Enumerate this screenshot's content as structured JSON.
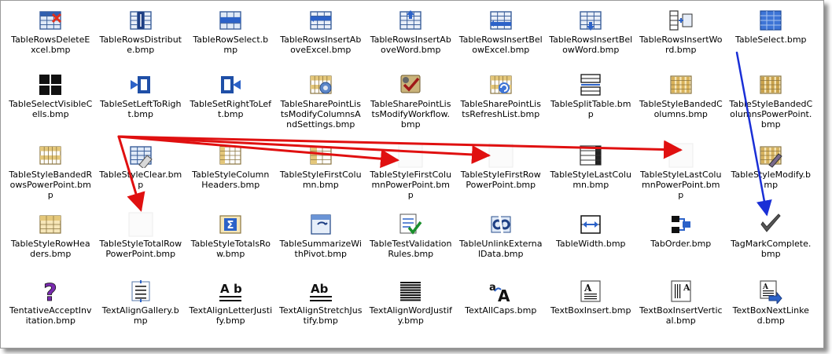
{
  "files": [
    {
      "label": "TableRowsDeleteExcel.bmp",
      "icon": "table-rows-delete-excel-icon"
    },
    {
      "label": "TableRowsDistribute.bmp",
      "icon": "table-rows-distribute-icon"
    },
    {
      "label": "TableRowSelect.bmp",
      "icon": "table-row-select-icon"
    },
    {
      "label": "TableRowsInsertAboveExcel.bmp",
      "icon": "table-rows-insert-above-excel-icon"
    },
    {
      "label": "TableRowsInsertAboveWord.bmp",
      "icon": "table-rows-insert-above-word-icon"
    },
    {
      "label": "TableRowsInsertBelowExcel.bmp",
      "icon": "table-rows-insert-below-excel-icon"
    },
    {
      "label": "TableRowsInsertBelowWord.bmp",
      "icon": "table-rows-insert-below-word-icon"
    },
    {
      "label": "TableRowsInsertWord.bmp",
      "icon": "table-rows-insert-word-icon"
    },
    {
      "label": "TableSelect.bmp",
      "icon": "table-select-icon"
    },
    {
      "label": "TableSelectVisibleCells.bmp",
      "icon": "table-select-visible-cells-icon"
    },
    {
      "label": "TableSetLeftToRight.bmp",
      "icon": "table-set-left-to-right-icon"
    },
    {
      "label": "TableSetRightToLeft.bmp",
      "icon": "table-set-right-to-left-icon"
    },
    {
      "label": "TableSharePointListsModifyColumnsAndSettings.bmp",
      "icon": "sharepoint-modify-columns-icon"
    },
    {
      "label": "TableSharePointListsModifyWorkflow.bmp",
      "icon": "sharepoint-modify-workflow-icon"
    },
    {
      "label": "TableSharePointListsRefreshList.bmp",
      "icon": "sharepoint-refresh-list-icon"
    },
    {
      "label": "TableSplitTable.bmp",
      "icon": "table-split-icon"
    },
    {
      "label": "TableStyleBandedColumns.bmp",
      "icon": "table-style-banded-columns-icon"
    },
    {
      "label": "TableStyleBandedColumnsPowerPoint.bmp",
      "icon": "table-style-banded-columns-powerpoint-icon"
    },
    {
      "label": "TableStyleBandedRowsPowerPoint.bmp",
      "icon": "table-style-banded-rows-icon"
    },
    {
      "label": "TableStyleClear.bmp",
      "icon": "table-style-clear-icon"
    },
    {
      "label": "TableStyleColumnHeaders.bmp",
      "icon": "table-style-column-headers-icon"
    },
    {
      "label": "TableStyleFirstColumn.bmp",
      "icon": "table-style-first-column-icon"
    },
    {
      "label": "TableStyleFirstColumnPowerPoint.bmp",
      "icon": "blank-icon"
    },
    {
      "label": "TableStyleFirstRowPowerPoint.bmp",
      "icon": "blank-icon"
    },
    {
      "label": "TableStyleLastColumn.bmp",
      "icon": "table-style-last-column-icon"
    },
    {
      "label": "TableStyleLastColumnPowerPoint.bmp",
      "icon": "blank-icon"
    },
    {
      "label": "TableStyleModify.bmp",
      "icon": "table-style-modify-icon"
    },
    {
      "label": "TableStyleRowHeaders.bmp",
      "icon": "table-style-row-headers-icon"
    },
    {
      "label": "TableStyleTotalRowPowerPoint.bmp",
      "icon": "blank-icon"
    },
    {
      "label": "TableStyleTotalsRow.bmp",
      "icon": "table-style-totals-row-icon"
    },
    {
      "label": "TableSummarizeWithPivot.bmp",
      "icon": "table-summarize-pivot-icon"
    },
    {
      "label": "TableTestValidationRules.bmp",
      "icon": "table-test-validation-icon"
    },
    {
      "label": "TableUnlinkExternalData.bmp",
      "icon": "table-unlink-external-icon"
    },
    {
      "label": "TableWidth.bmp",
      "icon": "table-width-icon"
    },
    {
      "label": "TabOrder.bmp",
      "icon": "tab-order-icon"
    },
    {
      "label": "TagMarkComplete.bmp",
      "icon": "checkmark-icon"
    },
    {
      "label": "TentativeAcceptInvitation.bmp",
      "icon": "question-mark-icon"
    },
    {
      "label": "TextAlignGallery.bmp",
      "icon": "text-align-gallery-icon"
    },
    {
      "label": "TextAlignLetterJustify.bmp",
      "icon": "text-align-letter-justify-icon"
    },
    {
      "label": "TextAlignStretchJustify.bmp",
      "icon": "text-align-stretch-justify-icon"
    },
    {
      "label": "TextAlignWordJustify.bmp",
      "icon": "text-align-word-justify-icon"
    },
    {
      "label": "TextAllCaps.bmp",
      "icon": "text-all-caps-icon"
    },
    {
      "label": "TextBoxInsert.bmp",
      "icon": "text-box-insert-icon"
    },
    {
      "label": "TextBoxInsertVertical.bmp",
      "icon": "text-box-insert-vertical-icon"
    },
    {
      "label": "TextBoxNextLinked.bmp",
      "icon": "text-box-next-linked-icon"
    }
  ],
  "colors": {
    "annotation_red": "#e01010",
    "annotation_blue": "#1a2fd6"
  }
}
